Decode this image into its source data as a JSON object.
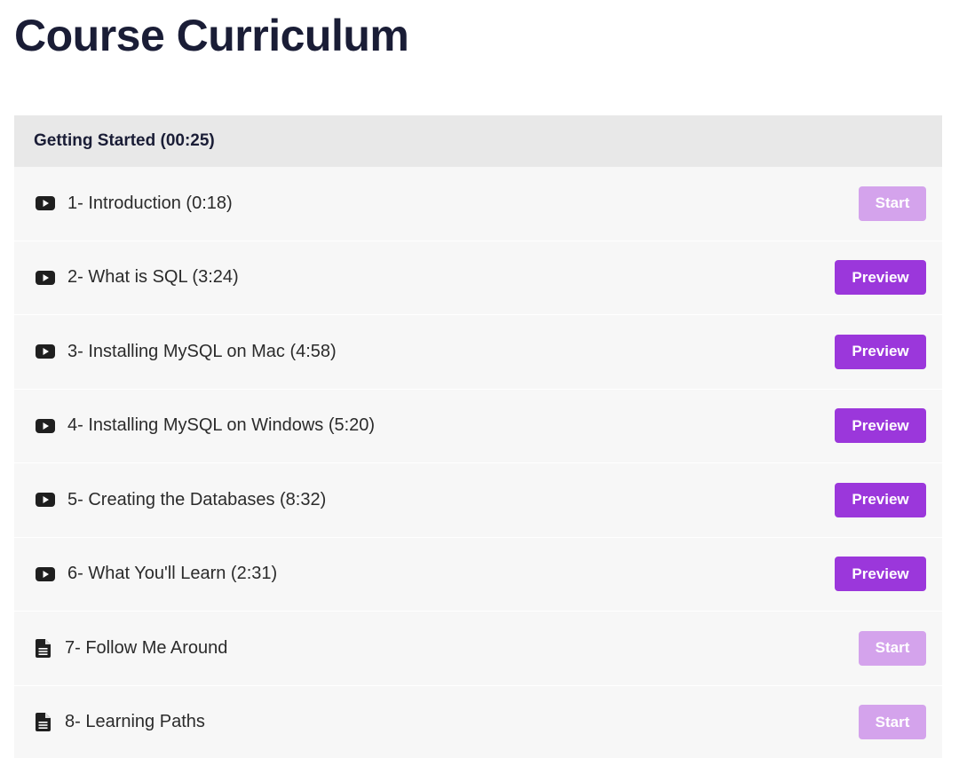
{
  "page": {
    "title": "Course Curriculum"
  },
  "section": {
    "title": "Getting Started (00:25)"
  },
  "colors": {
    "preview_button": "#9b37db",
    "start_button": "#d4a3ec",
    "title_text": "#1a1d36",
    "section_header_bg": "#e8e8e8",
    "row_bg": "#f7f7f7"
  },
  "lectures": [
    {
      "title": "1- Introduction (0:18)",
      "icon": "video-play-icon",
      "button": "Start",
      "button_type": "start"
    },
    {
      "title": "2- What is SQL (3:24)",
      "icon": "video-play-icon",
      "button": "Preview",
      "button_type": "preview"
    },
    {
      "title": "3- Installing MySQL on Mac (4:58)",
      "icon": "video-play-icon",
      "button": "Preview",
      "button_type": "preview"
    },
    {
      "title": "4- Installing MySQL on Windows (5:20)",
      "icon": "video-play-icon",
      "button": "Preview",
      "button_type": "preview"
    },
    {
      "title": "5- Creating the Databases (8:32)",
      "icon": "video-play-icon",
      "button": "Preview",
      "button_type": "preview"
    },
    {
      "title": "6- What You'll Learn (2:31)",
      "icon": "video-play-icon",
      "button": "Preview",
      "button_type": "preview"
    },
    {
      "title": "7- Follow Me Around",
      "icon": "document-icon",
      "button": "Start",
      "button_type": "start"
    },
    {
      "title": "8- Learning Paths",
      "icon": "document-icon",
      "button": "Start",
      "button_type": "start"
    }
  ]
}
